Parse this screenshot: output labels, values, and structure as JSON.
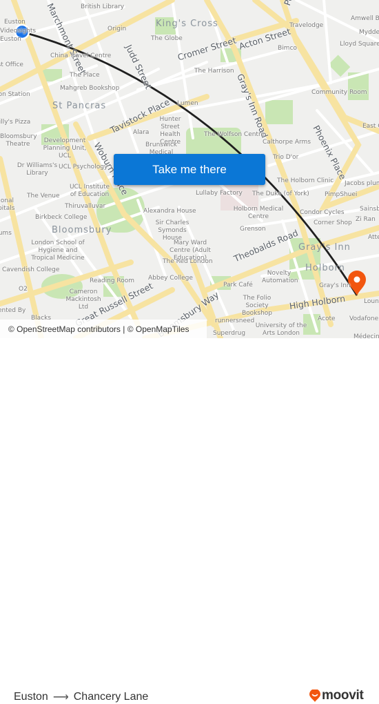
{
  "map": {
    "origin_marker_color": "#1a73e8",
    "destination_marker_color": "#f2560f",
    "route_line_color": "#1f1f1f",
    "area_labels": [
      "King's Cross",
      "St Pancras",
      "Bloomsbury",
      "Gray's Inn",
      "Holborn"
    ],
    "street_labels": [
      "Judd Street",
      "Cromer Street",
      "Acton Street",
      "Gray's Inn Road",
      "Tavistock Place",
      "Woburn Place",
      "Phoenix Place",
      "Theobalds Road",
      "High Holborn",
      "Great Russell Street",
      "Bloomsbury Way",
      "Marchmont Street",
      "Pentonville Road"
    ],
    "poi_labels": {
      "euston": "Euston",
      "videos": "Videosights",
      "euston2": "Euston",
      "ston": "Euston",
      "post_office": "Post Office",
      "euston_station": "Euston Station",
      "british_library": "British Library",
      "origin": "Origin",
      "china_travel": "China Travel Centre",
      "the_place": "The Place",
      "mahgreb": "Mahgreb Bookshop",
      "st_pancras_top": "St Pancras",
      "the_globe": "The Globe",
      "the_harrison": "The Harrison",
      "lumen": "Lumen",
      "hunter_street": "Hunter Street Health Centre",
      "alara": "Alara",
      "brunswick": "Brunswick Medical Centre",
      "wolfson": "The Wolfson Centre",
      "travelodge": "Travelodge",
      "bimco": "Bimco",
      "amwell": "Amwell Bookshop",
      "myddelton": "Myddelton",
      "lloyd_square": "Lloyd Square",
      "community_room": "Community Room",
      "east_c": "East C",
      "calthorpe": "Calthorpe Arms",
      "trio": "Trio D'or",
      "holborn_clinic": "The Holborn Clinic",
      "jacobs": "Jacobs plumbers",
      "duke": "The Duke (of York)",
      "pimpshuei": "PimpShuei",
      "condor": "Condor Cycles",
      "sainsburys": "Sainsbury's",
      "zi_ran": "Zi Ran",
      "corner_shop": "Corner Shop",
      "atte": "Attendant",
      "willys": "Willy's Pizza",
      "bloomsbury_theatre": "Bloomsbury Theatre",
      "dpu": "Development Planning Unit, UCL",
      "dr_williams": "Dr Williams's Library",
      "ucl_psych": "UCL Psychology",
      "ucl_ioe": "UCL Institute of Education",
      "the_venue": "The Venue",
      "thiruvalluvar": "Thiruvalluvar",
      "birkbeck": "Birkbeck College",
      "national": "National Hospitals",
      "atriums": "Atriums",
      "lshtm": "London School of Hygiene and Tropical Medicine",
      "cavendish": "Cavendish College",
      "o2": "O2",
      "reading_room": "Reading Room",
      "cameron": "Cameron Mackintosh Ltd",
      "presented": "Presented By",
      "blacks": "Blacks",
      "lullaby": "Lullaby Factory",
      "alexandra": "Alexandra House",
      "symonds": "Sir Charles Symonds House",
      "holborn_med": "Holborn Medical Centre",
      "grenson": "Grenson",
      "mary_ward": "Mary Ward Centre (Adult Education)",
      "red_london": "The Red London",
      "abbey": "Abbey College",
      "park_cafe": "Park Café",
      "novelty": "Novelty Automation",
      "folio": "The Folio Society Bookshop",
      "grays_inn_sq": "Gray's Inn",
      "lounge": "Lounge",
      "acote": "Acote",
      "vodafone": "Vodafone",
      "runnersneed": "runnersneed",
      "superdrug": "Superdrug",
      "ual": "University of the Arts London",
      "medecins": "Médecins"
    }
  },
  "cta": {
    "label": "Take me there"
  },
  "attribution": {
    "text": "© OpenStreetMap contributors | © OpenMapTiles"
  },
  "footer": {
    "origin": "Euston",
    "arrow": "⟶",
    "destination": "Chancery Lane",
    "brand": "moovit",
    "brand_color": "#f2560f"
  }
}
